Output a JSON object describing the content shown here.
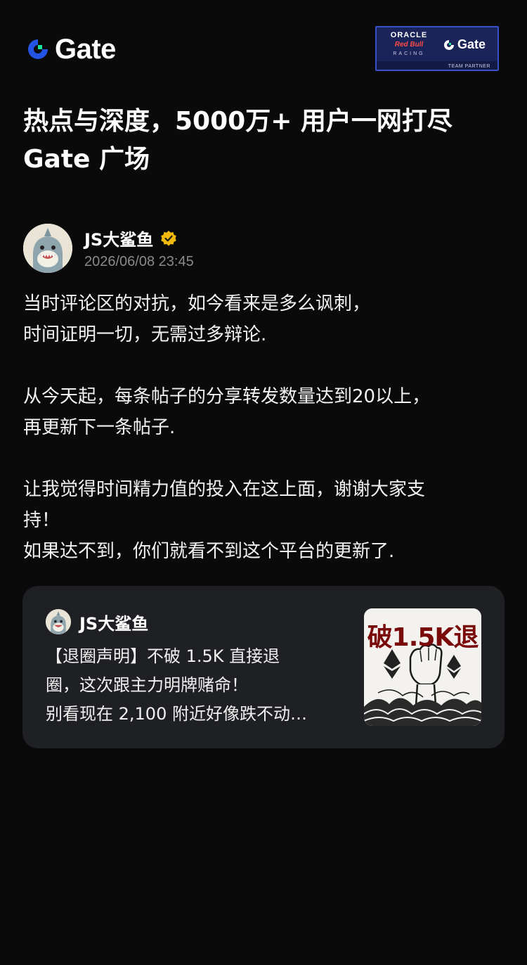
{
  "header": {
    "logo_text": "Gate",
    "partner": {
      "oracle": "ORACLE",
      "redbull": "Red Bull",
      "racing": "RACING",
      "gate": "Gate",
      "tag": "TEAM PARTNER"
    }
  },
  "headline": {
    "line1": "热点与深度，5000万+ 用户一网打尽",
    "line2": "Gate 广场"
  },
  "post": {
    "author_name": "JS大鲨鱼",
    "timestamp": "2026/06/08 23:45",
    "paragraphs": [
      [
        "当时评论区的对抗，如今看来是多么讽刺，",
        "时间证明一切，无需过多辩论."
      ],
      [
        "从今天起，每条帖子的分享转发数量达到20以上，",
        "再更新下一条帖子."
      ],
      [
        "让我觉得时间精力值的投入在这上面，谢谢大家支",
        "持！",
        "如果达不到，你们就看不到这个平台的更新了."
      ]
    ]
  },
  "quoted": {
    "author_name": "JS大鲨鱼",
    "lines": [
      "【退圈声明】不破 1.5K 直接退",
      "圈，这次跟主力明牌赌命！",
      "别看现在 2,100 附近好像跌不动…"
    ],
    "thumbnail_title": "破1.5K退"
  },
  "colors": {
    "background": "#0a0a0b",
    "card": "#1f2024",
    "brand_blue": "#2354e6",
    "brand_green": "#17e6a1",
    "verified_gold": "#f0b90b",
    "muted_text": "#8a8a8e"
  },
  "icons": {
    "logo": "gate-logo-icon",
    "verified": "verified-badge-icon"
  }
}
